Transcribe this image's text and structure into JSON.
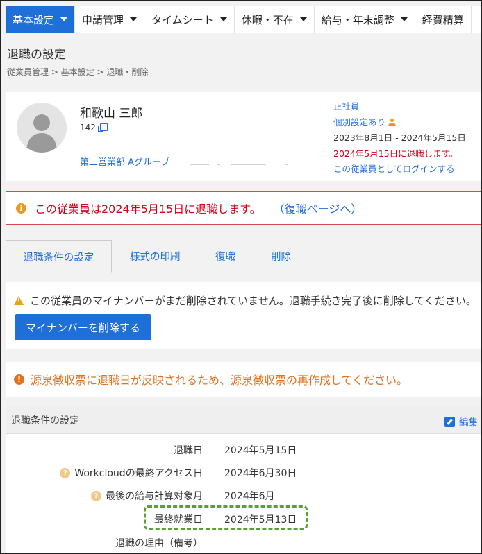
{
  "nav": {
    "items": [
      {
        "label": "基本設定",
        "dropdown": true,
        "active": true
      },
      {
        "label": "申請管理",
        "dropdown": true
      },
      {
        "label": "タイムシート",
        "dropdown": true
      },
      {
        "label": "休暇・不在",
        "dropdown": true
      },
      {
        "label": "給与・年末調整",
        "dropdown": true
      },
      {
        "label": "経費精算",
        "dropdown": false
      }
    ]
  },
  "page": {
    "title": "退職の設定",
    "breadcrumb": "従業員管理 > 基本設定 > 退職・削除"
  },
  "employee": {
    "name": "和歌山 三郎",
    "id": "142",
    "department": "第二営業部 Aグループ",
    "employment_type": "正社員",
    "custom_settings": "個別設定あり",
    "period": "2023年8月1日 - 2024年5月15日",
    "retirement_note": "2024年5月15日に退職します。",
    "login_as": "この従業員としてログインする"
  },
  "alert": {
    "text": "この従業員は2024年5月15日に退職します。",
    "link": "（復職ページへ）"
  },
  "tabs": [
    {
      "label": "退職条件の設定",
      "active": true
    },
    {
      "label": "様式の印刷"
    },
    {
      "label": "復職"
    },
    {
      "label": "削除"
    }
  ],
  "mynumber": {
    "warning": "この従業員のマイナンバーがまだ削除されていません。退職手続き完了後に削除してください。",
    "button": "マイナンバーを削除する"
  },
  "notice": {
    "text": "源泉徴収票に退職日が反映されるため、源泉徴収票の再作成してください。"
  },
  "settings": {
    "header": "退職条件の設定",
    "edit": "編集",
    "rows": [
      {
        "label": "退職日",
        "value": "2024年5月15日",
        "help": false
      },
      {
        "label": "Workcloudの最終アクセス日",
        "value": "2024年6月30日",
        "help": true
      },
      {
        "label": "最後の給与計算対象月",
        "value": "2024年6月",
        "help": true
      },
      {
        "label": "最終就業日",
        "value": "2024年5月13日",
        "help": false,
        "highlighted": true
      },
      {
        "label": "退職の理由（備考）",
        "value": "",
        "help": false
      }
    ]
  },
  "colors": {
    "accent": "#1f6fd8",
    "danger": "#d0021b",
    "warning": "#e2721d",
    "highlight": "#5aa132"
  }
}
